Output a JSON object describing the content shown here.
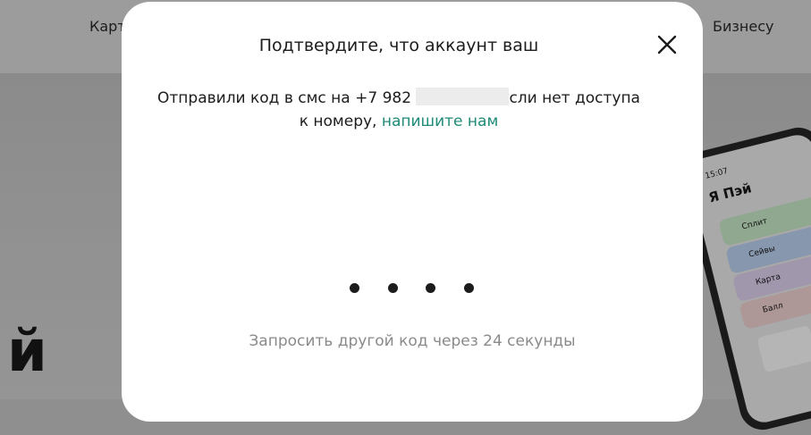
{
  "background": {
    "nav_left": "Карт",
    "nav_right": "Бизнесу",
    "hero_letter": "й",
    "phone": {
      "time": "15:07",
      "app_name": "Я Пэй",
      "cards": [
        "Сплит",
        "Сейвы",
        "Карта",
        "Балл"
      ]
    }
  },
  "modal": {
    "title": "Подтвердите, что аккаунт ваш",
    "close_icon": "close-icon",
    "message_prefix": "Отправили код в смс на +7 982",
    "message_suffix": "сли нет доступа",
    "message_line2": "к номеру,",
    "contact_link": "напишите нам",
    "code_length": 4,
    "resend_text": "Запросить другой код через 24 секунды"
  },
  "colors": {
    "link": "#1f8a78",
    "text": "#1c1c1c",
    "muted": "#8a8a8a",
    "overlay": "#8f8f8f"
  }
}
